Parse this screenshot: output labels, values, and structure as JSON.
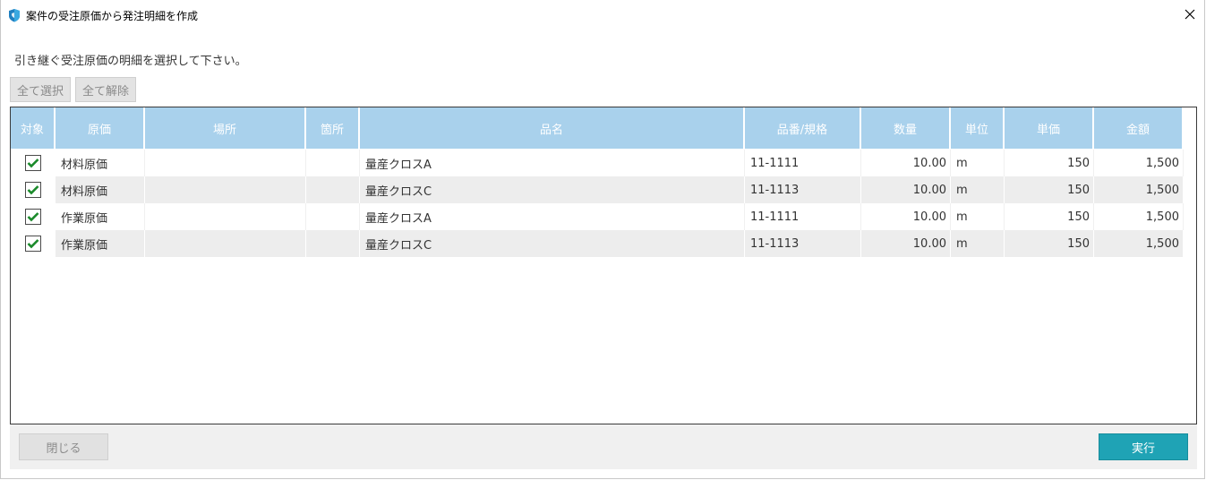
{
  "window": {
    "title": "案件の受注原価から発注明細を作成",
    "close_icon": "close-icon",
    "app_icon": "shield-app-icon"
  },
  "instruction": "引き継ぐ受注原価の明細を選択して下さい。",
  "toolbar": {
    "select_all_label": "全て選択",
    "deselect_all_label": "全て解除"
  },
  "grid": {
    "columns": [
      "対象",
      "原価",
      "場所",
      "箇所",
      "品名",
      "品番/規格",
      "数量",
      "単位",
      "単価",
      "金額"
    ],
    "rows": [
      {
        "checked": true,
        "cost_type": "材料原価",
        "location": "",
        "spot": "",
        "product": "量産クロスA",
        "code": "11-1111",
        "qty": "10.00",
        "unit": "m",
        "price": "150",
        "amount": "1,500"
      },
      {
        "checked": true,
        "cost_type": "材料原価",
        "location": "",
        "spot": "",
        "product": "量産クロスC",
        "code": "11-1113",
        "qty": "10.00",
        "unit": "m",
        "price": "150",
        "amount": "1,500"
      },
      {
        "checked": true,
        "cost_type": "作業原価",
        "location": "",
        "spot": "",
        "product": "量産クロスA",
        "code": "11-1111",
        "qty": "10.00",
        "unit": "m",
        "price": "150",
        "amount": "1,500"
      },
      {
        "checked": true,
        "cost_type": "作業原価",
        "location": "",
        "spot": "",
        "product": "量産クロスC",
        "code": "11-1113",
        "qty": "10.00",
        "unit": "m",
        "price": "150",
        "amount": "1,500"
      }
    ]
  },
  "footer": {
    "close_label": "閉じる",
    "execute_label": "実行"
  },
  "colors": {
    "header_bg": "#a9d1ec",
    "execute_bg": "#1fa3b5",
    "check_color": "#1a8a2a"
  }
}
